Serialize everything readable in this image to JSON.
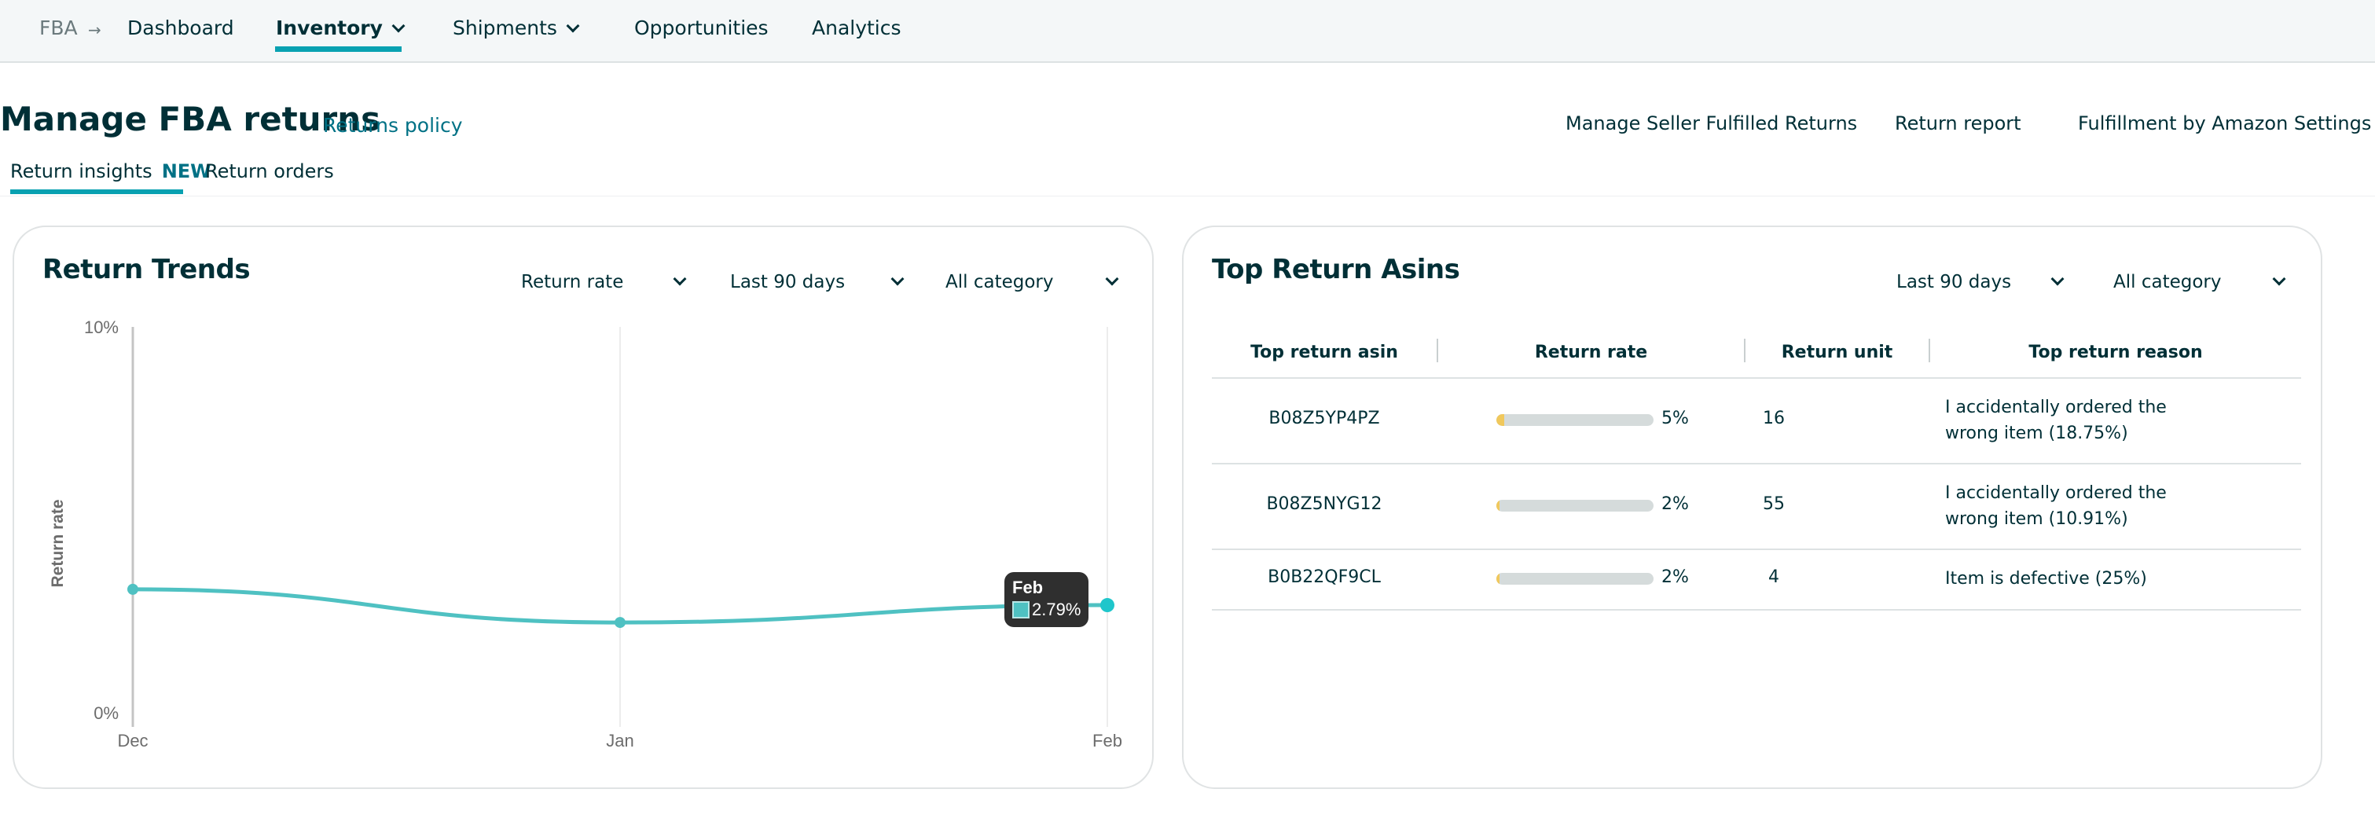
{
  "nav": {
    "root": "FBA",
    "separator_icon": "arrow-right-icon",
    "items": [
      {
        "label": "Dashboard",
        "dropdown": false,
        "active": false
      },
      {
        "label": "Inventory",
        "dropdown": true,
        "active": true
      },
      {
        "label": "Shipments",
        "dropdown": true,
        "active": false
      },
      {
        "label": "Opportunities",
        "dropdown": false,
        "active": false
      },
      {
        "label": "Analytics",
        "dropdown": false,
        "active": false
      }
    ]
  },
  "header": {
    "title": "Manage FBA returns",
    "policy_link": "Returns policy",
    "links": [
      "Manage Seller Fulfilled Returns",
      "Return report",
      "Fulfillment by Amazon Settings"
    ]
  },
  "tabs": [
    {
      "label": "Return insights",
      "badge": "NEW",
      "active": true
    },
    {
      "label": "Return orders",
      "active": false
    }
  ],
  "trends_card": {
    "title": "Return Trends",
    "filters": {
      "metric": "Return rate",
      "period": "Last 90 days",
      "category": "All category"
    },
    "tooltip": {
      "title": "Feb",
      "value": "2.79%"
    }
  },
  "chart_data": {
    "type": "line",
    "title": "Return Trends",
    "xlabel": "",
    "ylabel": "Return rate",
    "categories": [
      "Dec",
      "Jan",
      "Feb"
    ],
    "series": [
      {
        "name": "Return rate",
        "values": [
          3.2,
          2.34,
          2.79
        ],
        "color": "#4fc1c2"
      }
    ],
    "ylim": [
      0,
      10
    ],
    "y_ticks": [
      "0%",
      "10%"
    ],
    "y_tick_values": [
      0,
      10
    ],
    "grid": "vertical",
    "highlighted_point": {
      "category": "Feb",
      "value": 2.79
    }
  },
  "asins_card": {
    "title": "Top Return Asins",
    "filters": {
      "period": "Last 90 days",
      "category": "All category"
    },
    "columns": [
      "Top return asin",
      "Return rate",
      "Return unit",
      "Top return reason"
    ],
    "rows": [
      {
        "asin": "B08Z5YP4PZ",
        "rate_label": "5%",
        "rate_value": 5,
        "unit": "16",
        "reason": "I accidentally ordered the wrong item (18.75%)"
      },
      {
        "asin": "B08Z5NYG12",
        "rate_label": "2%",
        "rate_value": 2,
        "unit": "55",
        "reason": "I accidentally ordered the wrong item (10.91%)"
      },
      {
        "asin": "B0B22QF9CL",
        "rate_label": "2%",
        "rate_value": 2,
        "unit": "4",
        "reason": "Item is defective (25%)"
      }
    ]
  },
  "colors": {
    "accent": "#08a1b1",
    "link": "#007185",
    "text": "#002f36",
    "line": "#4fc1c2",
    "bar_fill": "#f0c85c",
    "bar_track": "#d5dbdb",
    "tooltip_bg": "#2f2f2f"
  }
}
